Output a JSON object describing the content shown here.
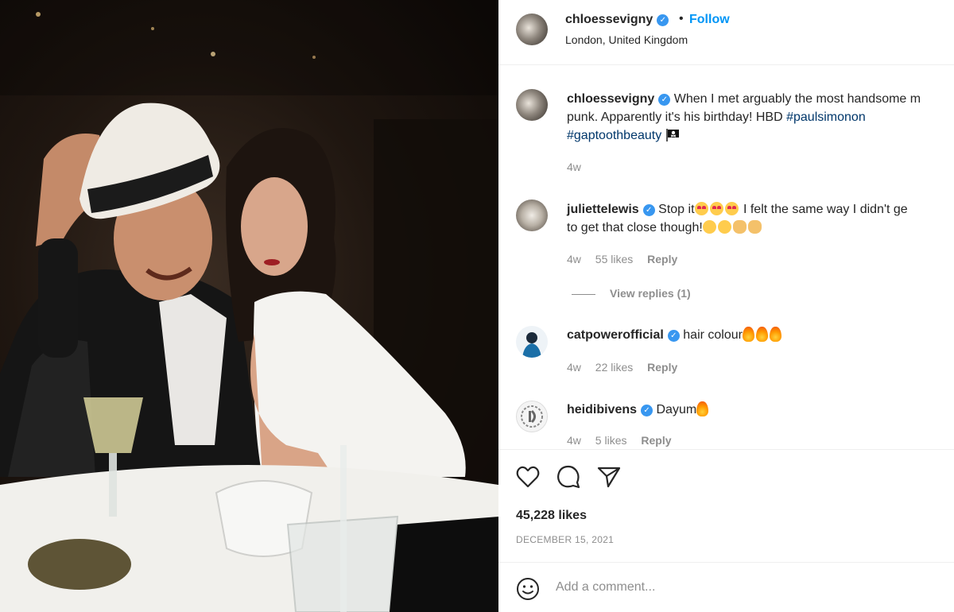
{
  "post": {
    "author": "chloessevigny",
    "separator": "•",
    "follow_label": "Follow",
    "location": "London, United Kingdom",
    "verified_icon": "✓",
    "caption": {
      "username": "chloessevigny",
      "text_line1": "When I met arguably the most handsome m",
      "text_line2": "punk. Apparently it's his birthday! HBD",
      "hashtag1": "#paulsimonon",
      "hashtag2": "#gaptoothbeauty",
      "age": "4w"
    },
    "comments": [
      {
        "username": "juliettelewis",
        "text_start": "Stop it",
        "text_mid": "I felt the same way I didn't ge",
        "text_line2": "to get that close though!",
        "age": "4w",
        "likes": "55 likes",
        "reply": "Reply",
        "view_replies": "View replies (1)"
      },
      {
        "username": "catpowerofficial",
        "text": "hair colour",
        "age": "4w",
        "likes": "22 likes",
        "reply": "Reply"
      },
      {
        "username": "heidibivens",
        "text": "Dayum",
        "age": "4w",
        "likes": "5 likes",
        "reply": "Reply"
      }
    ],
    "likes_count": "45,228 likes",
    "date": "DECEMBER 15, 2021",
    "add_comment_placeholder": "Add a comment..."
  },
  "colors": {
    "link": "#0095f6",
    "hashtag": "#00376b",
    "verified": "#3897f0",
    "muted": "#8e8e8e"
  },
  "icons": [
    "heart-icon",
    "comment-icon",
    "share-icon",
    "emoji-icon",
    "verified-icon",
    "pirate-flag-emoji",
    "fire-emoji"
  ]
}
